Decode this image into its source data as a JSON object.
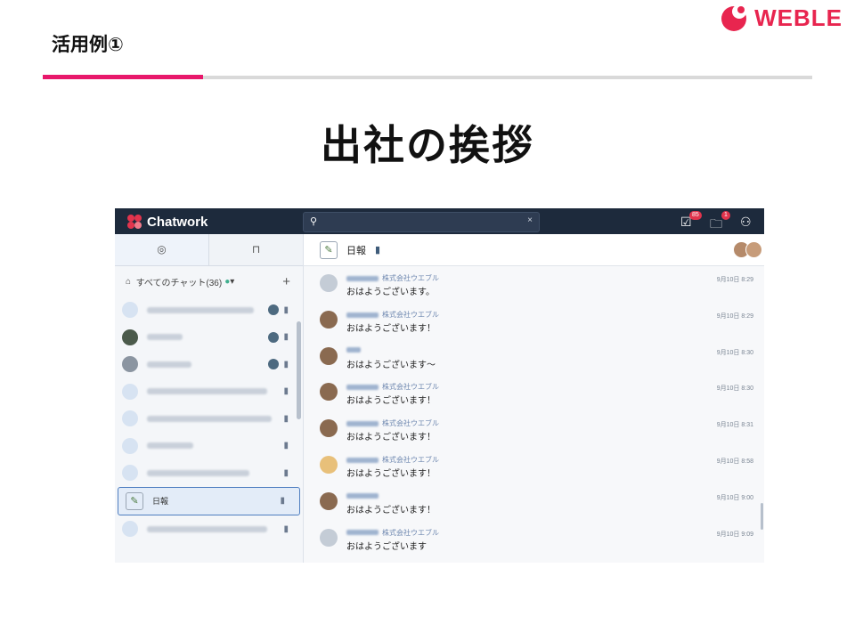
{
  "slide": {
    "heading": "活用例①",
    "brand": "WEBLE",
    "title": "出社の挨拶",
    "colors": {
      "accent": "#e8186b",
      "brand": "#e8254f"
    }
  },
  "app": {
    "name": "Chatwork",
    "search_icon": "🔍",
    "clear_icon": "×",
    "tasks_badge": "85",
    "files_badge": "1",
    "sidebar": {
      "tab_chat_icon": "chat-bubble-icon",
      "tab_bookmark_icon": "bookmark-icon",
      "all_chats_label": "すべてのチャット(36)",
      "add_label": "+",
      "rooms": [
        {
          "avatar": "blurred",
          "pin": "▮",
          "unread": true
        },
        {
          "avatar": "dark",
          "pin": "▮",
          "unread": true
        },
        {
          "avatar": "grey",
          "pin": "▮",
          "unread": true
        },
        {
          "avatar": "blurred",
          "pin": "▮"
        },
        {
          "avatar": "blurred",
          "pin": "▮"
        },
        {
          "avatar": "blurred",
          "pin": "▮"
        },
        {
          "avatar": "blurred",
          "pin": "▮"
        },
        {
          "avatar": "nippo",
          "name": "日報",
          "pin": "▮",
          "selected": true
        },
        {
          "avatar": "blurred",
          "pin": "▮"
        }
      ]
    },
    "chat": {
      "room_name": "日報",
      "messages": [
        {
          "company": "株式会社ウエブル",
          "text": "おはようございます。",
          "time": "9月10日 8:29"
        },
        {
          "company": "株式会社ウエブル",
          "text": "おはようございます！",
          "time": "9月10日 8:29"
        },
        {
          "company": "",
          "text": "おはようございます～",
          "time": "9月10日 8:30"
        },
        {
          "company": "株式会社ウエブル",
          "text": "おはようございます！",
          "time": "9月10日 8:30"
        },
        {
          "company": "株式会社ウエブル",
          "text": "おはようございます！",
          "time": "9月10日 8:31"
        },
        {
          "company": "株式会社ウエブル",
          "text": "おはようございます！",
          "time": "9月10日 8:58"
        },
        {
          "company": "",
          "text": "おはようございます！",
          "time": "9月10日 9:00"
        },
        {
          "company": "株式会社ウエブル",
          "text": "おはようございます",
          "time": "9月10日 9:09"
        }
      ]
    }
  }
}
